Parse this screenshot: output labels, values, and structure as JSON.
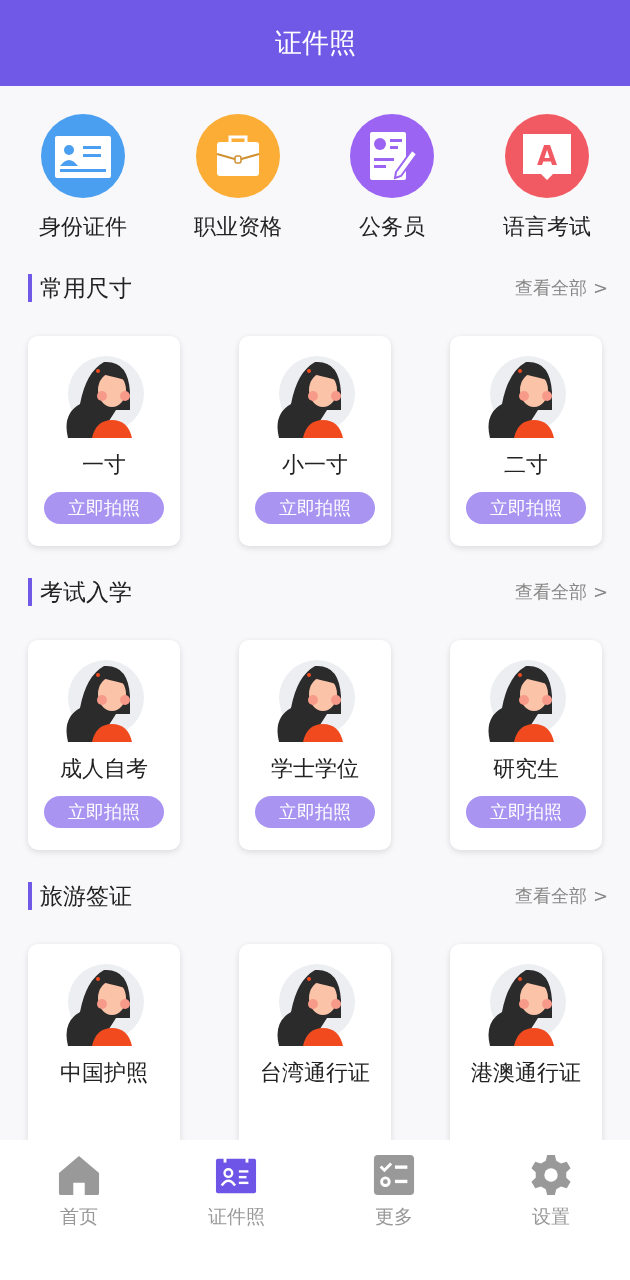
{
  "header": {
    "title": "证件照"
  },
  "categories": [
    {
      "label": "身份证件",
      "kind": "id-card",
      "color": "#4a9ff0"
    },
    {
      "label": "职业资格",
      "kind": "briefcase",
      "color": "#fbad36"
    },
    {
      "label": "公务员",
      "kind": "form",
      "color": "#9b64f2"
    },
    {
      "label": "语言考试",
      "kind": "language",
      "color": "#f25a63",
      "glyph": "A"
    }
  ],
  "sections": [
    {
      "title": "常用尺寸",
      "more": "查看全部 >",
      "cards": [
        {
          "name": "一寸",
          "button": "立即拍照"
        },
        {
          "name": "小一寸",
          "button": "立即拍照"
        },
        {
          "name": "二寸",
          "button": "立即拍照"
        }
      ]
    },
    {
      "title": "考试入学",
      "more": "查看全部 >",
      "cards": [
        {
          "name": "成人自考",
          "button": "立即拍照"
        },
        {
          "name": "学士学位",
          "button": "立即拍照"
        },
        {
          "name": "研究生",
          "button": "立即拍照"
        }
      ]
    },
    {
      "title": "旅游签证",
      "more": "查看全部 >",
      "cards": [
        {
          "name": "中国护照"
        },
        {
          "name": "台湾通行证"
        },
        {
          "name": "港澳通行证"
        }
      ]
    }
  ],
  "nav": [
    {
      "label": "首页",
      "kind": "home",
      "selected": false
    },
    {
      "label": "证件照",
      "kind": "photo",
      "selected": true
    },
    {
      "label": "更多",
      "kind": "list",
      "selected": false
    },
    {
      "label": "设置",
      "kind": "settings",
      "selected": false
    }
  ]
}
